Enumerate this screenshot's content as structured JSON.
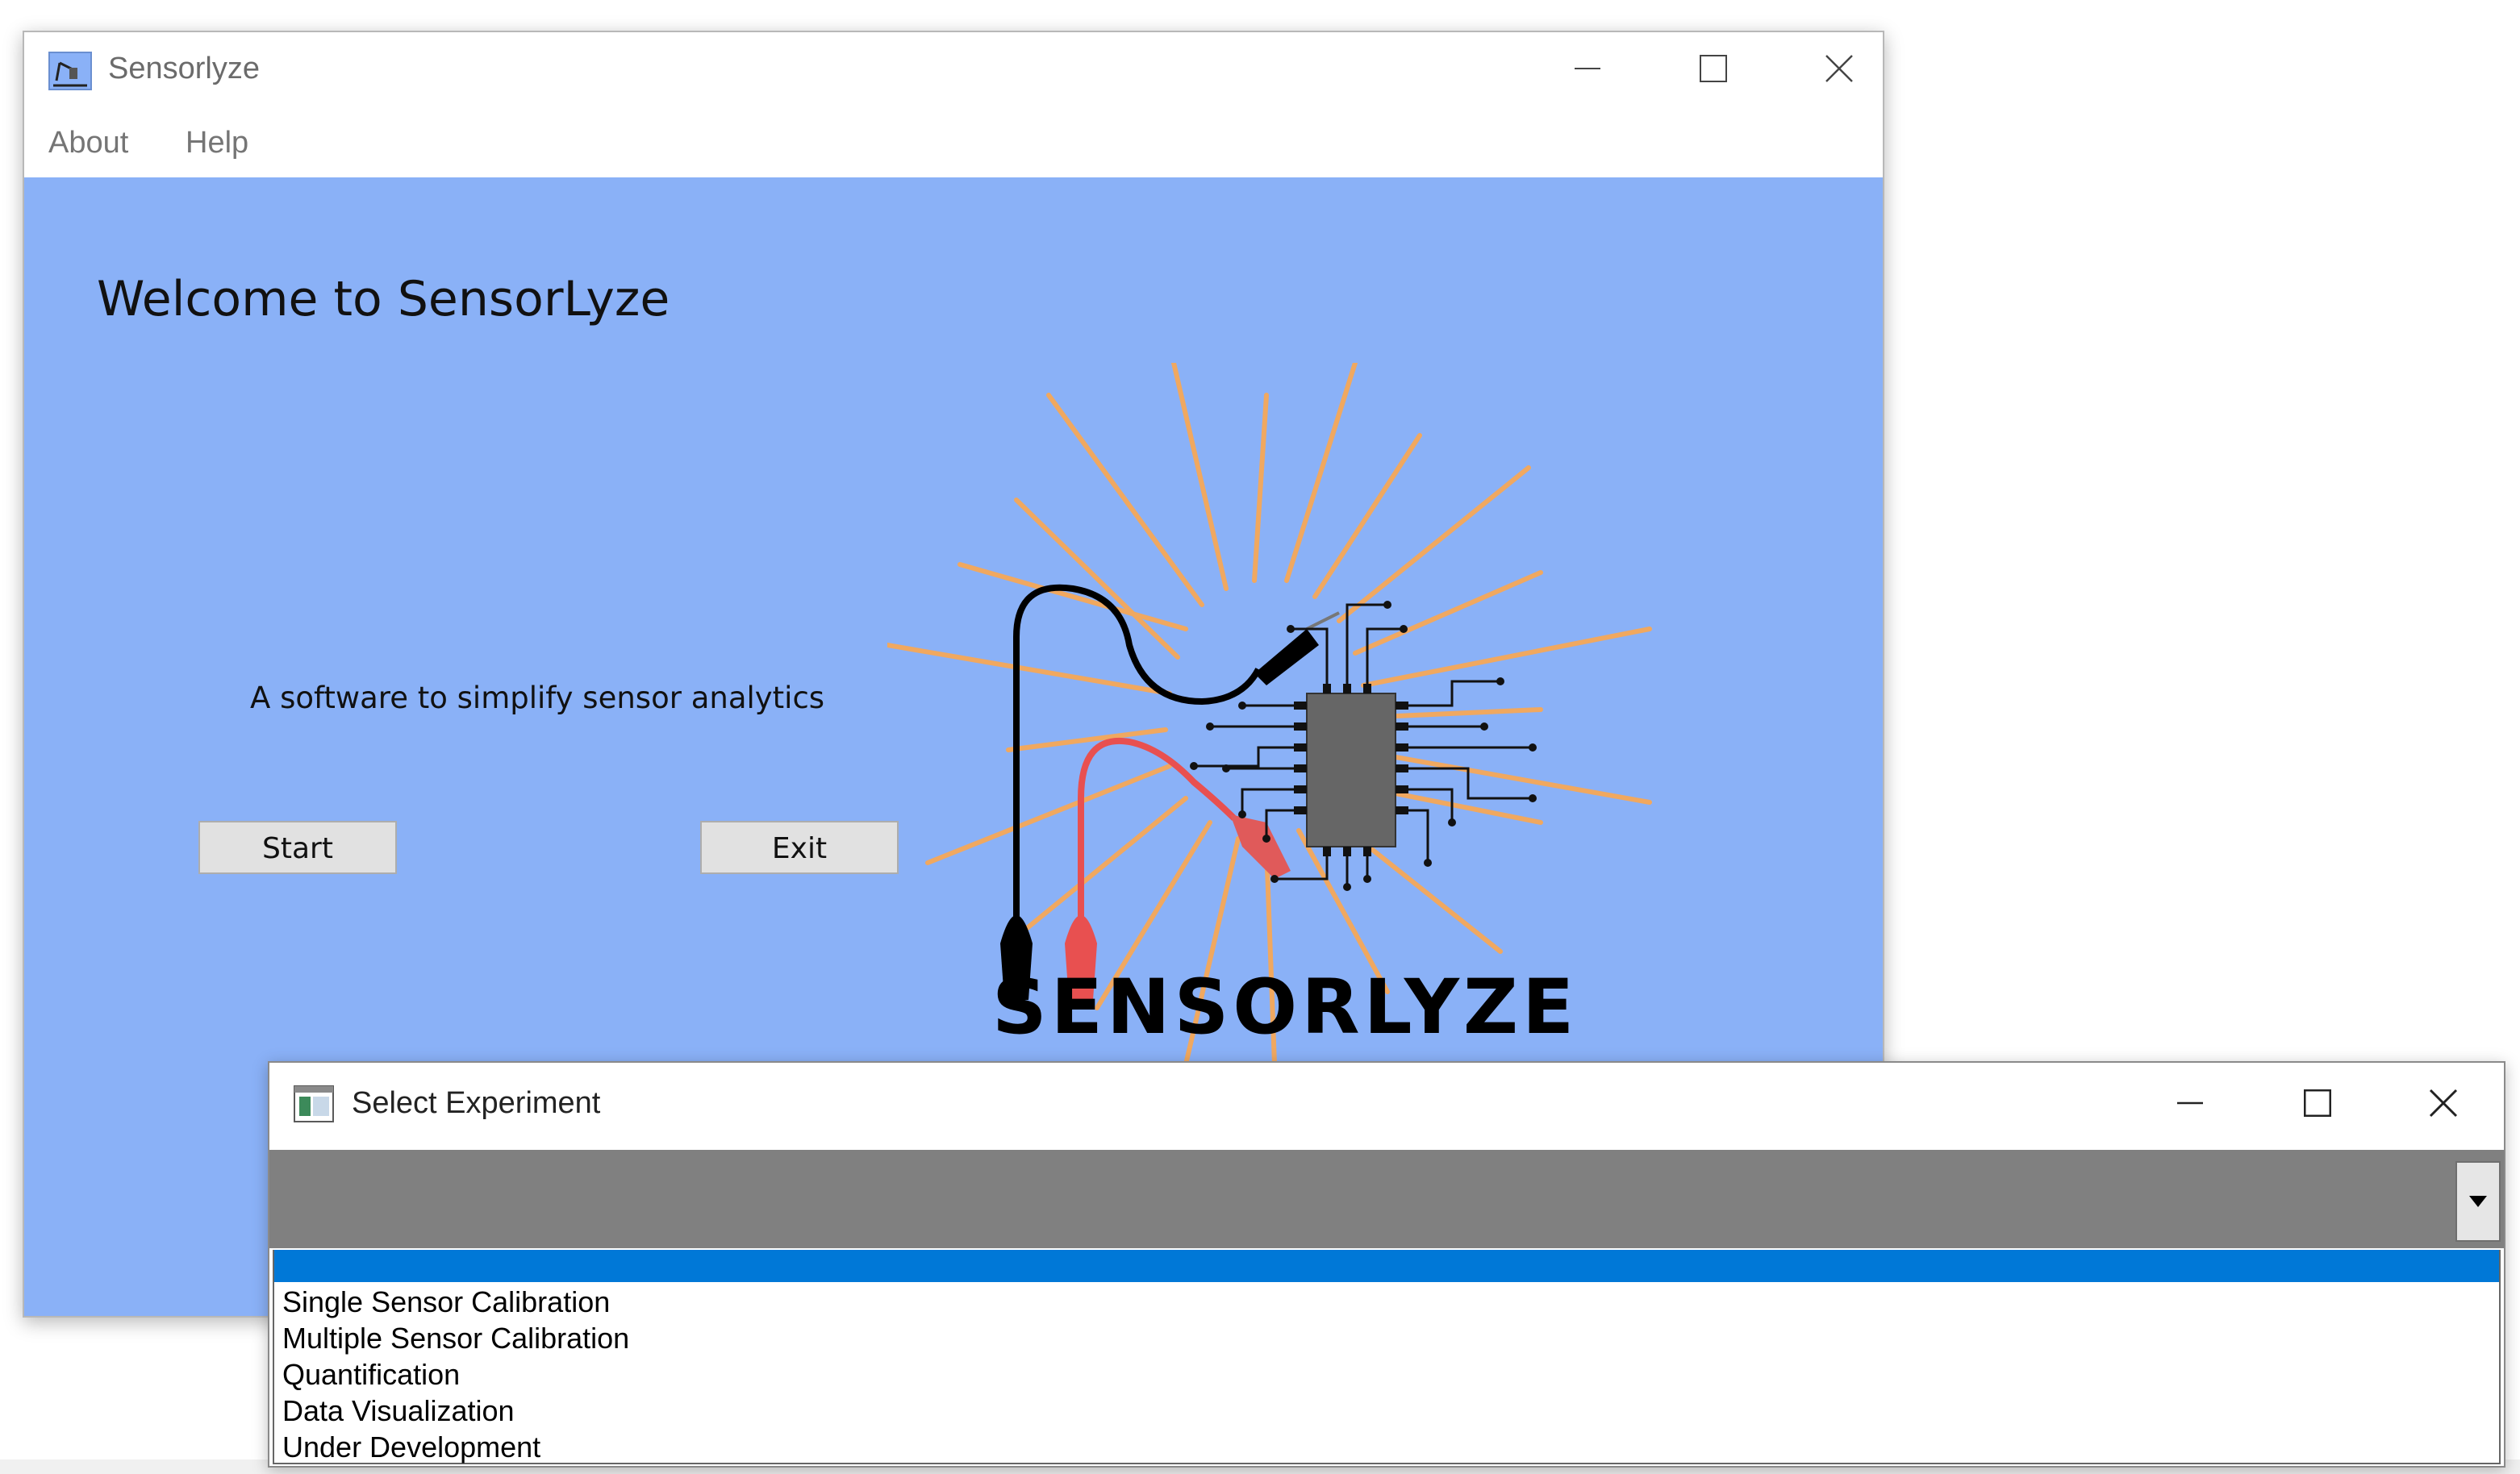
{
  "main_window": {
    "title": "Sensorlyze",
    "menu": [
      "About",
      "Help"
    ],
    "welcome_text": "Welcome to SensorLyze",
    "tagline": "A software to simplify sensor analytics",
    "start_label": "Start",
    "exit_label": "Exit",
    "logo_text": "SENSORLYZE",
    "background_color": "#8ab1f7"
  },
  "dialog": {
    "title": "Select Experiment",
    "combo_value": "",
    "options": [
      "Single Sensor Calibration",
      "Multiple Sensor Calibration",
      "Quantification",
      "Data Visualization",
      "Under Development"
    ],
    "selection_color": "#0078d7"
  },
  "icons": [
    "app-icon",
    "minimize-icon",
    "maximize-icon",
    "close-icon",
    "dialog-icon",
    "dropdown-arrow-icon",
    "sensorlyze-logo"
  ]
}
